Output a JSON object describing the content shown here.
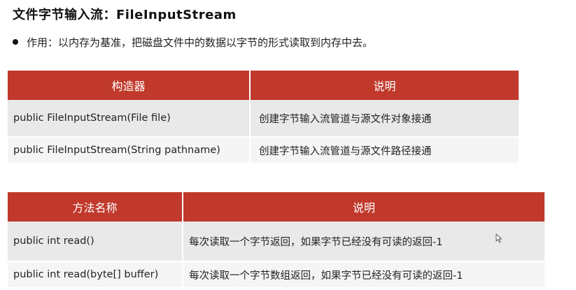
{
  "title": "文件字节输入流：FileInputStream",
  "bullet": {
    "text": "作用：以内存为基准，把磁盘文件中的数据以字节的形式读取到内存中去。"
  },
  "constructors_table": {
    "headers": [
      "构造器",
      "说明"
    ],
    "rows": [
      [
        "public FileInputStream(File file)",
        "创建字节输入流管道与源文件对象接通"
      ],
      [
        "public FileInputStream(String pathname)",
        "创建字节输入流管道与源文件路径接通"
      ]
    ]
  },
  "methods_table": {
    "headers": [
      "方法名称",
      "说明"
    ],
    "rows": [
      [
        "public int read()",
        "每次读取一个字节返回，如果字节已经没有可读的返回-1"
      ],
      [
        "public int read(byte[] buffer)",
        "每次读取一个字节数组返回，如果字节已经没有可读的返回-1"
      ]
    ]
  },
  "colors": {
    "header_bg": "#c0392b",
    "row_bg_1": "#e9e9e9",
    "row_bg_2": "#f5f5f5"
  },
  "icons": {
    "bullet": "bullet-dot-icon",
    "cursor": "mouse-cursor-icon"
  }
}
